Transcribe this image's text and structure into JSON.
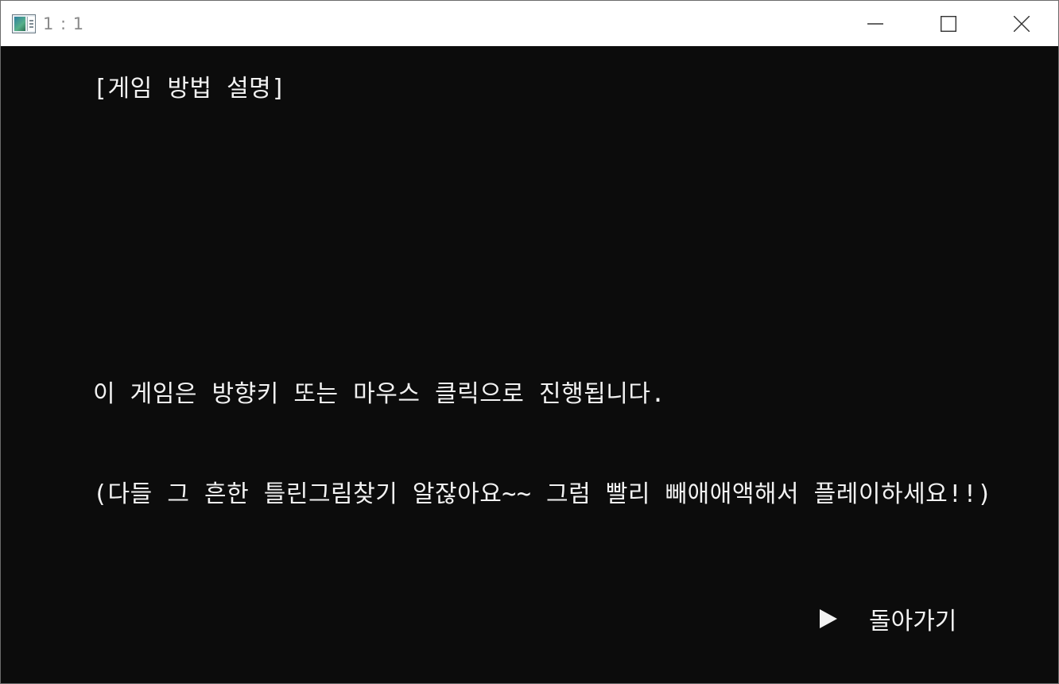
{
  "window": {
    "title": "1 : 1",
    "icon": "console-app-icon"
  },
  "controls": {
    "minimize_icon": "minimize-icon",
    "maximize_icon": "maximize-icon",
    "close_icon": "close-icon"
  },
  "console": {
    "heading": "[게임 방법 설명]",
    "instruction": "이 게임은 방향키 또는 마우스 클릭으로 진행됩니다.",
    "note": "(다들 그 흔한 틀린그림찾기 알잖아요~~ 그럼 빨리 빼애애액해서 플레이하세요!!)",
    "menu": {
      "selector_icon": "play-triangle-icon",
      "back_label": "돌아가기"
    }
  }
}
